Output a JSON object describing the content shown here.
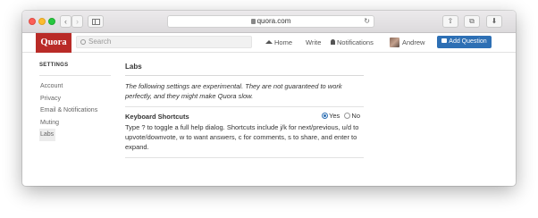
{
  "browser": {
    "url": "quora.com",
    "back_icon": "chevron-left-icon",
    "forward_icon": "chevron-right-icon",
    "reload_icon": "reload-icon",
    "glyphs": {
      "back": "‹",
      "forward": "›",
      "reload": "↻",
      "share": "⇧",
      "tabs": "⧉",
      "download": "⬇"
    }
  },
  "header": {
    "logo": "Quora",
    "search_placeholder": "Search",
    "nav": {
      "home": "Home",
      "write": "Write",
      "notifications": "Notifications",
      "user": "Andrew"
    },
    "add_question": "Add Question",
    "brand_color": "#b92b27",
    "button_color": "#2d6fb4"
  },
  "settings": {
    "heading": "SETTINGS",
    "items": [
      {
        "label": "Account"
      },
      {
        "label": "Privacy"
      },
      {
        "label": "Email & Notifications"
      },
      {
        "label": "Muting"
      },
      {
        "label": "Labs"
      }
    ],
    "active_item": "Labs"
  },
  "labs": {
    "title": "Labs",
    "warning": "The following settings are experimental. They are not guaranteed to work perfectly, and they might make Quora slow.",
    "keyboard_shortcuts": {
      "label": "Keyboard Shortcuts",
      "yes": "Yes",
      "no": "No",
      "selected": "Yes",
      "description": "Type ? to toggle a full help dialog. Shortcuts include j/k for next/previous, u/d to upvote/downvote, w to want answers, c for comments, s to share, and enter to expand."
    }
  }
}
